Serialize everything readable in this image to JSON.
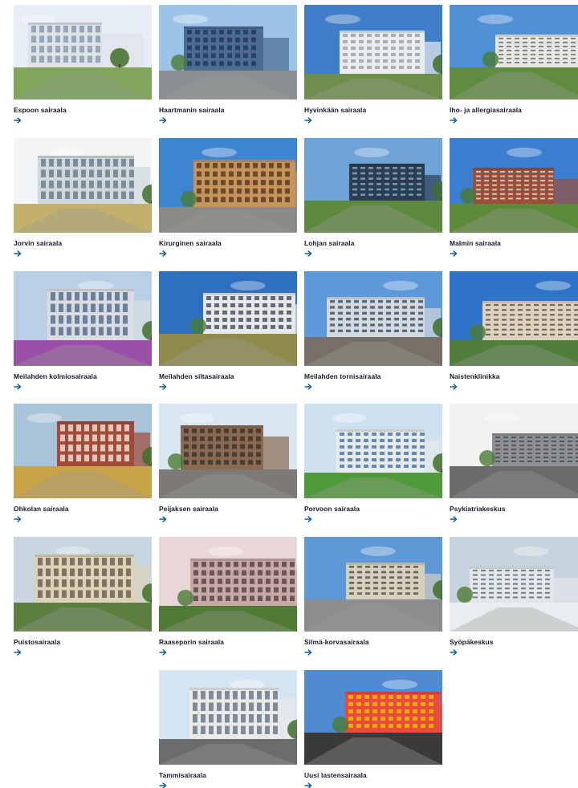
{
  "colors": {
    "link_arrow": "#0a5aa3",
    "title_text": "#111827"
  },
  "hospitals": [
    {
      "name": "Espoon sairaala",
      "arrow_icon": "arrow-right-icon",
      "palette": {
        "sky": "#e7edf4",
        "building": "#dfe3e8",
        "window": "#8a9bb0",
        "ground": "#7fa65a"
      }
    },
    {
      "name": "Haartmanin sairaala",
      "arrow_icon": "arrow-right-icon",
      "palette": {
        "sky": "#9ec3e8",
        "building": "#4a6c95",
        "window": "#233a5c",
        "ground": "#8a8f92"
      }
    },
    {
      "name": "Hyvinkään sairaala",
      "arrow_icon": "arrow-right-icon",
      "palette": {
        "sky": "#3f7fc9",
        "building": "#e9ecee",
        "window": "#9aa4ae",
        "ground": "#6e8f4b"
      }
    },
    {
      "name": "Iho- ja allergiasairaala",
      "arrow_icon": "arrow-right-icon",
      "palette": {
        "sky": "#4f8fd6",
        "building": "#e8e6e1",
        "window": "#6b7380",
        "ground": "#5f8c3f"
      }
    },
    {
      "name": "Jorvin sairaala",
      "arrow_icon": "arrow-right-icon",
      "palette": {
        "sky": "#f2f4f6",
        "building": "#cfd8dc",
        "window": "#6e7f8c",
        "ground": "#c4b06a"
      }
    },
    {
      "name": "Kirurginen sairaala",
      "arrow_icon": "arrow-right-icon",
      "palette": {
        "sky": "#3c85cf",
        "building": "#c7955c",
        "window": "#5b3c22",
        "ground": "#8a8a86"
      }
    },
    {
      "name": "Lohjan sairaala",
      "arrow_icon": "arrow-right-icon",
      "palette": {
        "sky": "#6ea3d8",
        "building": "#2c3d52",
        "window": "#7fa6c6",
        "ground": "#5f8a3e"
      }
    },
    {
      "name": "Malmin sairaala",
      "arrow_icon": "arrow-right-icon",
      "palette": {
        "sky": "#3c7fd0",
        "building": "#9a4f3a",
        "window": "#e0d7cc",
        "ground": "#5b8a3a"
      }
    },
    {
      "name": "Meilahden kolmiosairaala",
      "arrow_icon": "arrow-right-icon",
      "palette": {
        "sky": "#b8cfe6",
        "building": "#d9dde3",
        "window": "#5a6e8c",
        "ground": "#9b4fa8"
      }
    },
    {
      "name": "Meilahden siltasairaala",
      "arrow_icon": "arrow-right-icon",
      "palette": {
        "sky": "#2f6fc0",
        "building": "#e6e8ea",
        "window": "#4a5566",
        "ground": "#8e8a4a"
      }
    },
    {
      "name": "Meilahden tornisairaala",
      "arrow_icon": "arrow-right-icon",
      "palette": {
        "sky": "#5d98d8",
        "building": "#d5d8dc",
        "window": "#3f5872",
        "ground": "#77706a"
      }
    },
    {
      "name": "Naistenklinikka",
      "arrow_icon": "arrow-right-icon",
      "palette": {
        "sky": "#2f74c8",
        "building": "#ddd2bd",
        "window": "#5a5349",
        "ground": "#4f7f3a"
      }
    },
    {
      "name": "Ohkolan sairaala",
      "arrow_icon": "arrow-right-icon",
      "palette": {
        "sky": "#a9c4d8",
        "building": "#a24b3a",
        "window": "#e9dccf",
        "ground": "#c9a347"
      }
    },
    {
      "name": "Peijaksen sairaala",
      "arrow_icon": "arrow-right-icon",
      "palette": {
        "sky": "#d9e6f1",
        "building": "#8c6a52",
        "window": "#3a3530",
        "ground": "#7d7a76"
      }
    },
    {
      "name": "Porvoon sairaala",
      "arrow_icon": "arrow-right-icon",
      "palette": {
        "sky": "#cfe0ee",
        "building": "#e7e9ea",
        "window": "#4a7ab0",
        "ground": "#4f9a3b"
      }
    },
    {
      "name": "Psykiatriakeskus",
      "arrow_icon": "arrow-right-icon",
      "palette": {
        "sky": "#f1f1f1",
        "building": "#8d8f92",
        "window": "#4a4d52",
        "ground": "#6b6b6b"
      }
    },
    {
      "name": "Puistosairaala",
      "arrow_icon": "arrow-right-icon",
      "palette": {
        "sky": "#c7d6e0",
        "building": "#dcd2b8",
        "window": "#6e6452",
        "ground": "#5a7f3f"
      }
    },
    {
      "name": "Raaseporin sairaala",
      "arrow_icon": "arrow-right-icon",
      "palette": {
        "sky": "#e9d6d8",
        "building": "#c9a9a6",
        "window": "#5a4848",
        "ground": "#4f7a34"
      }
    },
    {
      "name": "Silmä-korvasairaala",
      "arrow_icon": "arrow-right-icon",
      "palette": {
        "sky": "#5f98d6",
        "building": "#d6cfbd",
        "window": "#55504a",
        "ground": "#8a8c8e"
      }
    },
    {
      "name": "Syöpäkeskus",
      "arrow_icon": "arrow-right-icon",
      "palette": {
        "sky": "#c6d3de",
        "building": "#e3e6e9",
        "window": "#5b6c7c",
        "ground": "#e9edf0"
      }
    },
    {
      "name": "Tammisairaala",
      "arrow_icon": "arrow-right-icon",
      "palette": {
        "sky": "#d5e4f1",
        "building": "#e9eaec",
        "window": "#6f7a86",
        "ground": "#6a6c6e"
      }
    },
    {
      "name": "Uusi lastensairaala",
      "arrow_icon": "arrow-right-icon",
      "palette": {
        "sky": "#4f8ad2",
        "building": "#e74c3c",
        "window": "#f5b800",
        "ground": "#3a3a3a"
      }
    }
  ]
}
